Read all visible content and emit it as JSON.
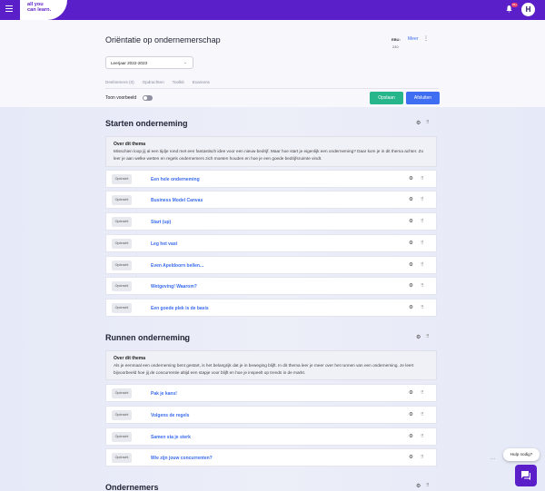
{
  "brand": {
    "logo_text": "all you\ncan learn.",
    "primary_color": "#5b1fc9"
  },
  "topbar": {
    "notification_count": "99+",
    "avatar_initial": "H"
  },
  "header": {
    "title": "Oriëntatie op ondernemerschap",
    "ebu_label": "EBU:",
    "ebu_value": "240",
    "meer_label": "Meer",
    "year_select": "Leerjaar 2022-2023",
    "tabs": [
      "Deelnemers (0)",
      "Opdrachten",
      "Toolkit",
      "Examens"
    ],
    "toggle_label": "Toon voorbeeld",
    "save_label": "Opslaan",
    "close_label": "Afsluiten"
  },
  "sections": [
    {
      "title": "Starten onderneming",
      "about_title": "Over dit thema",
      "about_text": "Misschien loop jij al een tijdje rond met een fantastisch idee voor een nieuw bedrijf. Maar hoe start je eigenlijk een onderneming? Daar kom je in dit thema achter. Zo leer je aan welke wetten en regels ondernemers zich moeten houden en hoe je een goede bedrijfsruimte vindt.",
      "items": [
        {
          "badge": "Opdracht",
          "title": "Een hele onderneming"
        },
        {
          "badge": "Opdracht",
          "title": "Business Model Canvas"
        },
        {
          "badge": "Opdracht",
          "title": "Start (up)"
        },
        {
          "badge": "Opdracht",
          "title": "Leg het vast"
        },
        {
          "badge": "Opdracht",
          "title": "Even Apeldoorn bellen..."
        },
        {
          "badge": "Opdracht",
          "title": "Wetgeving! Waarom?"
        },
        {
          "badge": "Opdracht",
          "title": "Een goede plek is de basis"
        }
      ]
    },
    {
      "title": "Runnen onderneming",
      "about_title": "Over dit thema",
      "about_text": "Als je eenmaal een onderneming bent gestart, is het belangrijk dat je in beweging blijft. In dit thema leer je meer over het runnen van een onderneming. Je leert bijvoorbeeld hoe jij de concurrentie altijd een stapje voor blijft en hoe je inspeelt op trends in de markt.",
      "items": [
        {
          "badge": "Opdracht",
          "title": "Pak je kans!"
        },
        {
          "badge": "Opdracht",
          "title": "Volgens de regels"
        },
        {
          "badge": "Opdracht",
          "title": "Samen sta je sterk"
        },
        {
          "badge": "Opdracht",
          "title": "Wie zijn jouw concurrenten?"
        }
      ]
    },
    {
      "title": "Ondernemers"
    }
  ],
  "help": {
    "bubble_text": "Hulp nodig?"
  }
}
